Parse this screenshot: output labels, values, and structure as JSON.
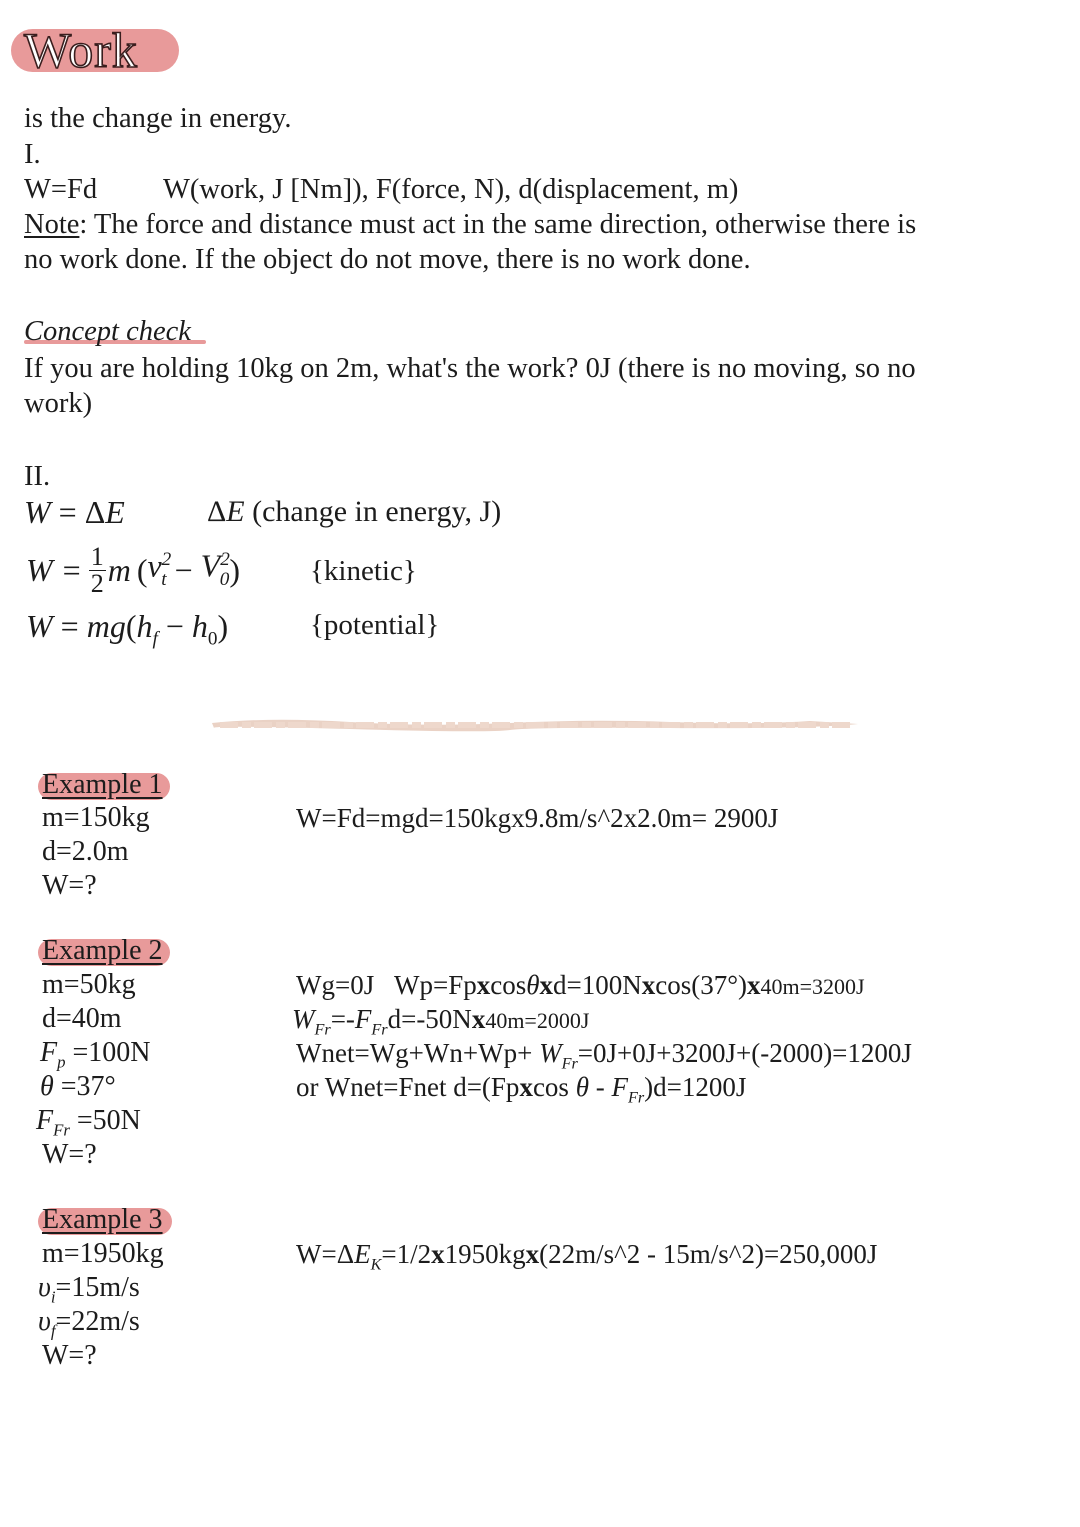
{
  "title": "Work",
  "intro": "is the change in energy.",
  "section1": {
    "label": "I.",
    "formula": "W=Fd",
    "legend": "W(work, J [Nm]), F(force, N), d(displacement, m)",
    "note_label": "Note",
    "note_line1": ": The force and distance must act in the same direction, otherwise there is",
    "note_line2": "no work done. If the object do not move, there is no work done."
  },
  "concept_check": {
    "heading": "Concept check",
    "line1": "If you are holding 10kg on 2m, what's the work?  0J (there is no moving, so no",
    "line2": "work)"
  },
  "section2": {
    "label": "II.",
    "eq1_lhs": "W",
    "eq1_rhs": "= ΔE",
    "eq1_note_sym": "ΔE",
    "eq1_note": " (change in energy, J)",
    "eq2_lhs": "W",
    "eq2_eq": "=",
    "eq2_num": "1",
    "eq2_den": "2",
    "eq2_body": "m (v",
    "eq2_tag": "{kinetic}",
    "eq3": "W = mg(h",
    "eq3_tag": "{potential}"
  },
  "examples": [
    {
      "title": "Example 1",
      "givens": [
        "m=150kg",
        "d=2.0m",
        "W=?"
      ],
      "solution": [
        "W=Fd=mgd=150kgx9.8m/s^2x2.0m= 2900J"
      ]
    },
    {
      "title": "Example 2",
      "givens": [
        "m=50kg",
        "d=40m",
        "Fp =100N",
        "θ =37°",
        "FFr =50N",
        "W=?"
      ],
      "solution": [
        "Wg=0J   Wp=Fpxcosθxd=100Nxcos(37°)x40m=3200J",
        "WFr=-FFrd=-50Nx40m=2000J",
        "Wnet=Wg+Wn+Wp+ WFr=0J+0J+3200J+(-2000)=1200J",
        "or Wnet=Fnet d=(Fpxcos θ - FFr)d=1200J"
      ]
    },
    {
      "title": "Example 3",
      "givens": [
        "m=1950kg",
        "vi=15m/s",
        "vf=22m/s",
        "W=?"
      ],
      "solution": [
        "W=ΔEK=1/2x1950kgx(22m/s^2 - 15m/s^2)=250,000J"
      ]
    }
  ],
  "colors": {
    "highlight": "#e89a9a",
    "divider": "#e8cdbf",
    "text": "#1c1c1c"
  }
}
